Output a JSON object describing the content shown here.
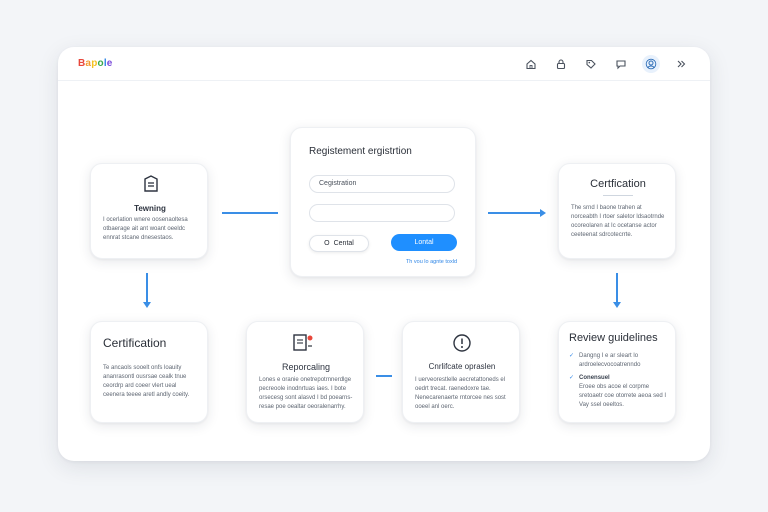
{
  "app": {
    "logo_letters": [
      "B",
      "a",
      "p",
      "o",
      "l",
      "e"
    ],
    "logo_colors": [
      "#e8473b",
      "#f29b2f",
      "#f4c21f",
      "#39a84b",
      "#2f86e6",
      "#7a4ad9"
    ]
  },
  "toolbar": {
    "icons": [
      "home-icon",
      "lock-icon",
      "tag-icon",
      "chat-icon",
      "profile-icon",
      "forward-icon"
    ]
  },
  "registration": {
    "title": "Registement ergistrtion",
    "field1_value": "Cegistration",
    "field2_value": "",
    "cancel_label": "Cental",
    "cancel_prefix": "O",
    "submit_label": "Lontal",
    "link_text": "Th vou lo agnte toxld"
  },
  "training": {
    "title": "Tewning",
    "body": "I ocerlation wnere oosenaoltesa otbaerage ait ant woant oeeldc ennrat stcane dnesestaos."
  },
  "certification_top": {
    "title": "Certfication",
    "body": "The srnd I baone trahen at norceabth I rtoer saletor ldsaotrnde ocoreolaren at Ic ocetanse actor ceeteenat sdrcotecrrte."
  },
  "certification_left": {
    "title": "Certification",
    "body": "Te ancaols sooelt onfs loauity ananrasontl ousrsae cealk tnue ceordrp ard coeer vlert ueal ceenera teeee aretl andly coeity."
  },
  "reporting": {
    "title": "Reporcaling",
    "body": "Lones e oranie onetrepotrnnerdlge pecreoole inodnrtuas iaes. I bote orsecesg sont alasvd  I bd poearns-resae poe oealtar oeoralenarrhy."
  },
  "certificate_option": {
    "title": "Cnrlifcate opraslen",
    "body": "I uerveorestlelle aecretattoneds el oedrt trecat. raenedoxre tae. Nenecarenaerte rntorcee nes sost ooeel anl oerc."
  },
  "review": {
    "title": "Review guidelines",
    "item1": "Dangng I e ar sleart lo ardroelecvocoatrenndo",
    "item2_title": "Conensuel",
    "item2_body": "Eroee obs acoe el corpme sretoaetr coe otorrete aeoa sed I Vay ssel oeeltos."
  },
  "colors": {
    "accent": "#1f8fff",
    "connector": "#3a8ee6"
  }
}
